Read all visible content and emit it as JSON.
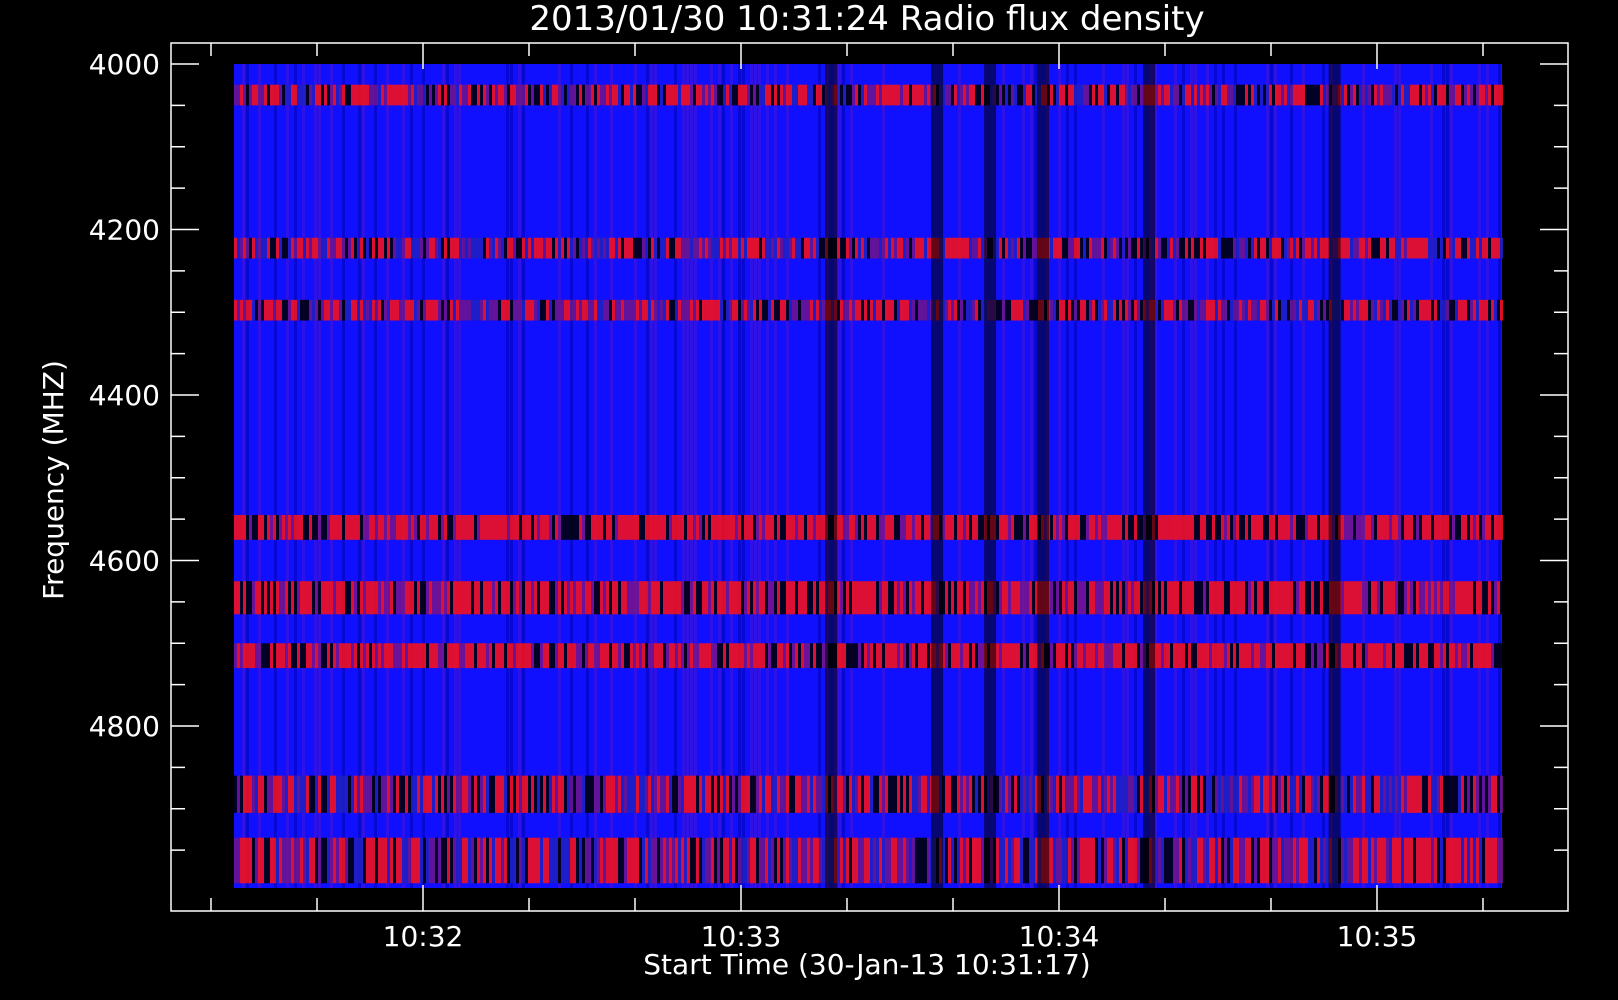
{
  "chart_data": {
    "type": "heatmap",
    "title": "2013/01/30 10:31:24 Radio flux density",
    "xlabel": "Start Time (30-Jan-13 10:31:17)",
    "ylabel": "Frequency (MHZ)",
    "x_ticks": [
      "10:32",
      "10:33",
      "10:34",
      "10:35"
    ],
    "y_ticks": [
      4000,
      4200,
      4400,
      4600,
      4800
    ],
    "ylim": [
      4000,
      5000
    ],
    "x_range": [
      "10:31:17",
      "10:35:25"
    ],
    "y_inverted": true,
    "colormap": [
      "#000000",
      "#1010ff",
      "#ff1010"
    ],
    "bands": [
      {
        "freq_start": 4025,
        "freq_end": 4050,
        "level": "warm"
      },
      {
        "freq_start": 4210,
        "freq_end": 4235,
        "level": "warm"
      },
      {
        "freq_start": 4285,
        "freq_end": 4310,
        "level": "warm"
      },
      {
        "freq_start": 4545,
        "freq_end": 4575,
        "level": "hot"
      },
      {
        "freq_start": 4625,
        "freq_end": 4665,
        "level": "hot"
      },
      {
        "freq_start": 4700,
        "freq_end": 4730,
        "level": "hot"
      },
      {
        "freq_start": 4860,
        "freq_end": 4905,
        "level": "warm"
      },
      {
        "freq_start": 4935,
        "freq_end": 4990,
        "level": "warm"
      }
    ],
    "dark_times": [
      "10:33:17",
      "10:33:37",
      "10:33:47",
      "10:33:57",
      "10:34:17",
      "10:34:52"
    ]
  },
  "colors": {
    "background": "#000000",
    "axis": "#ffffff"
  }
}
